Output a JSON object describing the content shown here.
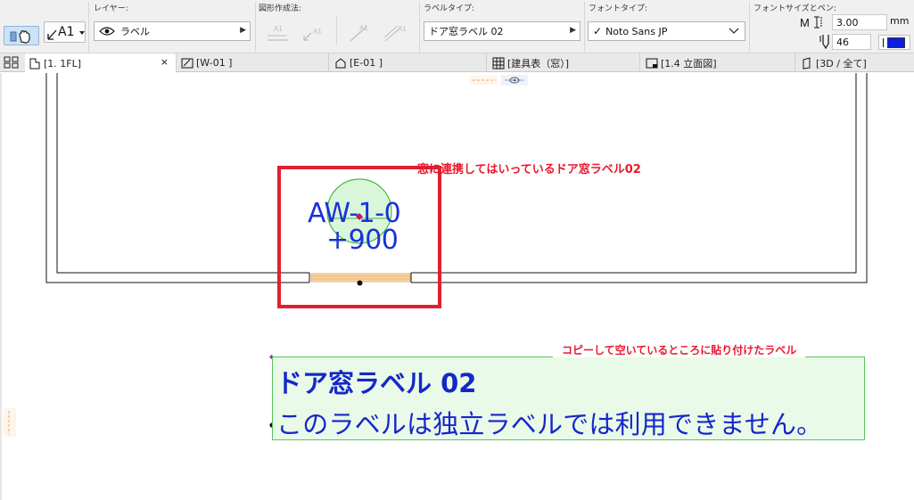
{
  "toolbar": {
    "layer_section_label": "レイヤー:",
    "layer_value": "ラベル",
    "shape_section_label": "図形作成法:",
    "label_type_section_label": "ラベルタイプ:",
    "label_type_value": "ドア窓ラベル 02",
    "font_type_section_label": "フォントタイプ:",
    "font_value": "Noto Sans JP",
    "font_size_section_label": "フォントサイズとペン:",
    "font_size_value": "3.00",
    "font_size_unit": "mm",
    "pen_value": "46",
    "label_button_text": "A1",
    "ghost_text": "A1"
  },
  "tabs": [
    {
      "label": "[1. 1FL]",
      "active": true,
      "close": "×"
    },
    {
      "label": "[W-01 ]"
    },
    {
      "label": "[E-01 ]"
    },
    {
      "label": "[建具表（窓）]"
    },
    {
      "label": "[1.4 立面図]"
    },
    {
      "label": "[3D / 全て]"
    }
  ],
  "canvas": {
    "window_tag_line1": "AW-1-0",
    "window_tag_line2": "+900",
    "annotation_linked": "窓に連携してはいっているドア窓ラベル02",
    "annotation_copied": "コピーして空いているところに貼り付けたラベル",
    "independent_label_title": "ドア窓ラベル 02",
    "independent_label_message": "このラベルは独立ラベルでは利用できません。"
  },
  "colors": {
    "label_text": "#1428c8",
    "annotation_red": "#e8192c",
    "label_bg": "#e9fae9",
    "label_border": "#59c45c",
    "highlight_box": "#e02030",
    "window_fill": "#f6d7a8"
  }
}
